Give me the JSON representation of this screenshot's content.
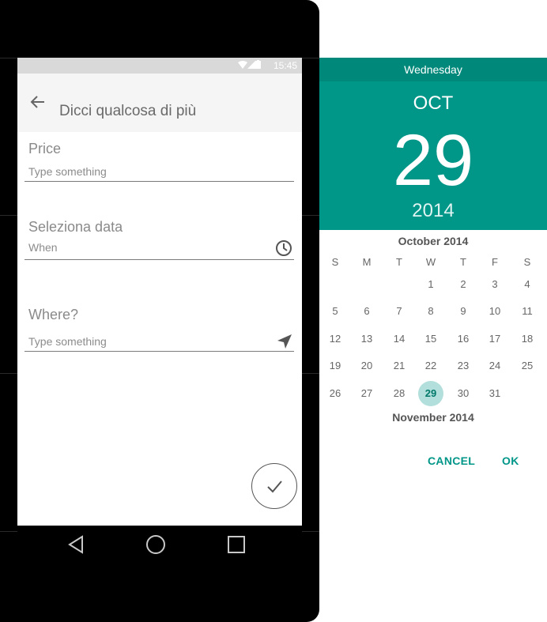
{
  "status_bar": {
    "time": "15:45"
  },
  "toolbar": {
    "title": "Dicci qualcosa di più"
  },
  "form": {
    "price": {
      "label": "Price",
      "placeholder": "Type something"
    },
    "date": {
      "label": "Seleziona data",
      "value": "When"
    },
    "where": {
      "label": "Where?",
      "placeholder": "Type something"
    }
  },
  "date_picker": {
    "weekday": "Wednesday",
    "month_short": "OCT",
    "day": "29",
    "year": "2014",
    "current_month_title": "October 2014",
    "next_month_title": "November 2014",
    "weekday_headers": [
      "S",
      "M",
      "T",
      "W",
      "T",
      "F",
      "S"
    ],
    "days": [
      "1",
      "2",
      "3",
      "4",
      "5",
      "6",
      "7",
      "8",
      "9",
      "10",
      "11",
      "12",
      "13",
      "14",
      "15",
      "16",
      "17",
      "18",
      "19",
      "20",
      "21",
      "22",
      "23",
      "24",
      "25",
      "26",
      "27",
      "28",
      "29",
      "30",
      "31"
    ],
    "first_weekday_index": 3,
    "selected_day": 29,
    "cancel_label": "CANCEL",
    "ok_label": "OK"
  },
  "colors": {
    "accent": "#009688",
    "accent_dark": "#00897b",
    "selected_bg": "#b2dfdb"
  },
  "icons": {
    "back": "arrow-back-icon",
    "clock": "clock-icon",
    "location": "navigation-arrow-icon",
    "confirm": "check-icon",
    "nav_back": "triangle-back-icon",
    "nav_home": "circle-home-icon",
    "nav_recents": "square-recents-icon"
  }
}
